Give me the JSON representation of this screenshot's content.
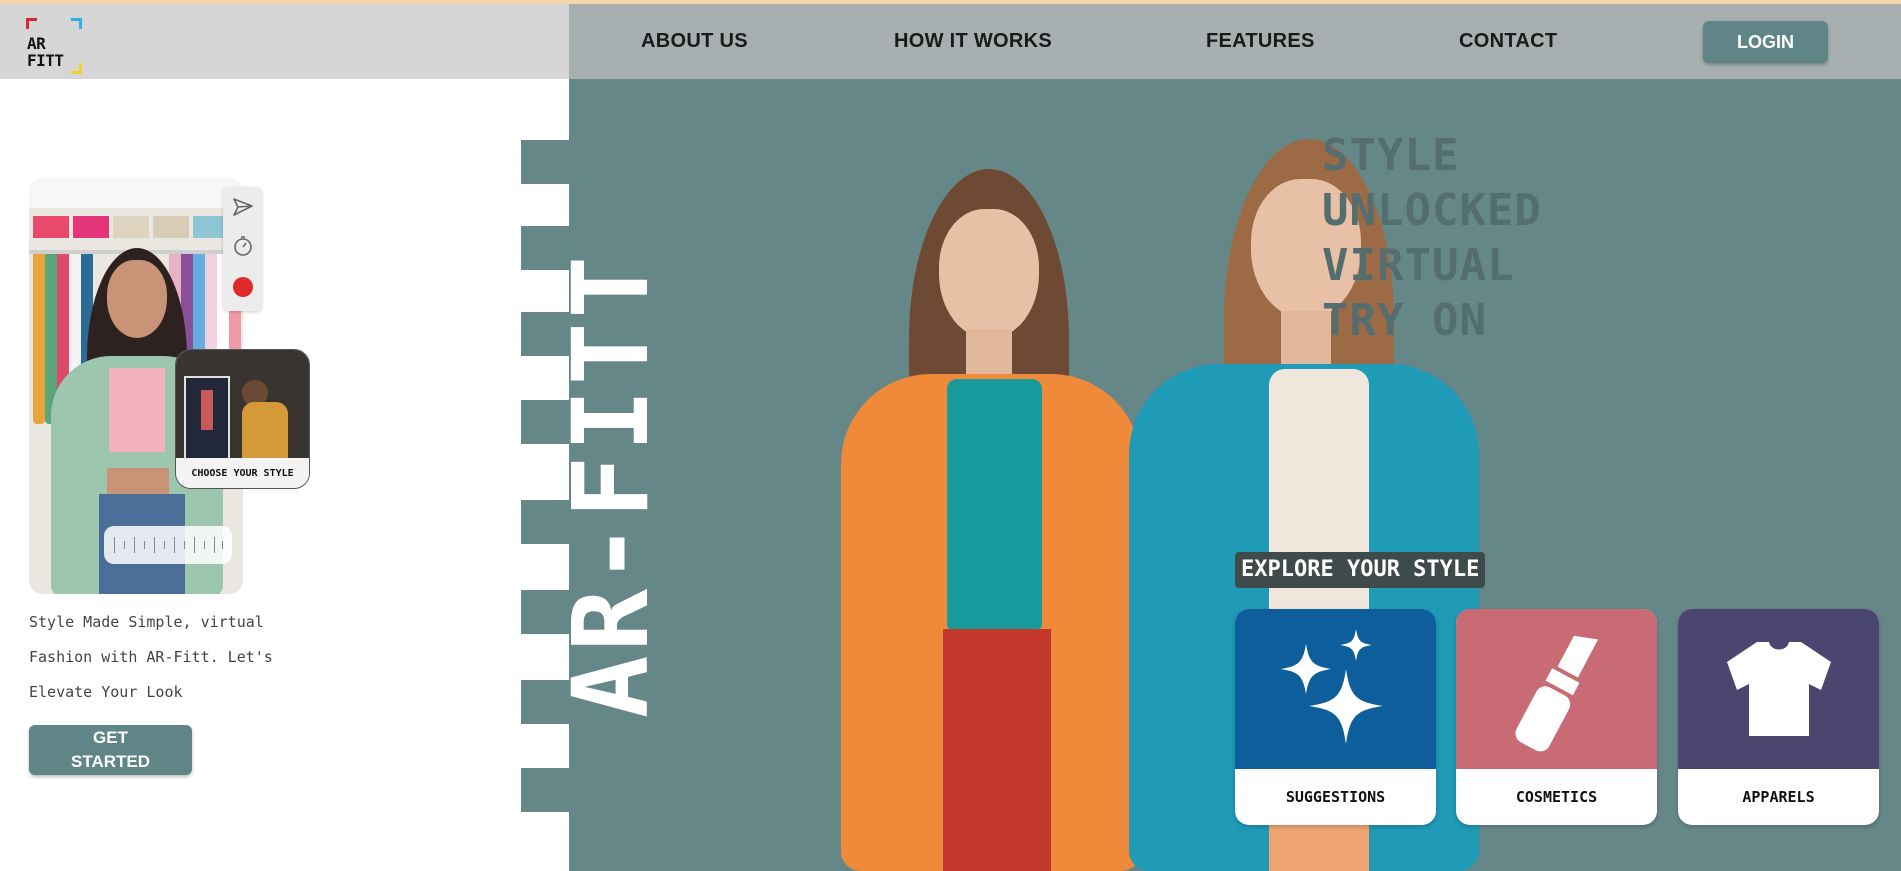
{
  "app": {
    "logo_text_line1": "AR",
    "logo_text_line2": "FITT",
    "brand_vertical": "AR-FITT",
    "accent_color": "#5f8586",
    "hero_bg_color": "#668788"
  },
  "nav": {
    "items": [
      {
        "label": "ABOUT US"
      },
      {
        "label": "HOW IT WORKS"
      },
      {
        "label": "FEATURES"
      },
      {
        "label": "CONTACT"
      }
    ],
    "login_label": "LOGIN"
  },
  "hero": {
    "headline_lines": [
      "STYLE",
      "UNLOCKED",
      "VIRTUAL",
      "TRY ON"
    ],
    "explore_label": "EXPLORE YOUR STYLE",
    "cards": [
      {
        "label": "SUGGESTIONS",
        "icon": "sparkles-icon",
        "color": "#0f5e9c"
      },
      {
        "label": "COSMETICS",
        "icon": "lipstick-icon",
        "color": "#c86b74"
      },
      {
        "label": "APPARELS",
        "icon": "tshirt-icon",
        "color": "#4a4670"
      }
    ]
  },
  "left_panel": {
    "tools": [
      "send-icon",
      "timer-icon",
      "record-icon"
    ],
    "thumb_label": "CHOOSE YOUR STYLE",
    "tagline_lines": [
      "Style Made Simple, virtual",
      "Fashion with AR-Fitt. Let's",
      "Elevate Your Look"
    ],
    "cta_line1": "GET",
    "cta_line2": "STARTED"
  }
}
